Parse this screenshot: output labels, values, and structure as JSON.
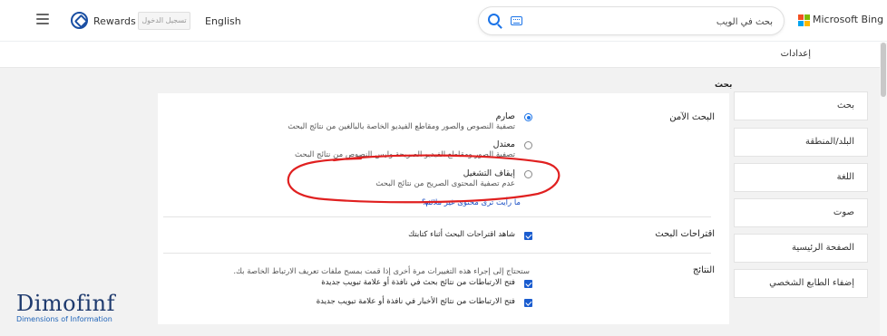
{
  "header": {
    "rewards_label": "Rewards",
    "signin_label": "تسجيل الدخول",
    "language_link": "English",
    "search_placeholder": "بحث في الويب",
    "brand": "Microsoft Bing"
  },
  "colors": {
    "accent": "#1a73e8",
    "annotation": "#e02020",
    "microsoft_logo": [
      "#f25022",
      "#7fba00",
      "#00a4ef",
      "#ffb900"
    ]
  },
  "page": {
    "title": "إعدادات",
    "section_label": "بحث"
  },
  "nav": {
    "items": [
      {
        "label": "بحث"
      },
      {
        "label": "البلد/المنطقة"
      },
      {
        "label": "اللغة"
      },
      {
        "label": "صوت"
      },
      {
        "label": "الصفحة الرئيسية"
      },
      {
        "label": "إضفاء الطابع الشخصي"
      }
    ]
  },
  "safe_search": {
    "label": "البحث الآمن",
    "selected": "strict",
    "options": [
      {
        "id": "strict",
        "title": "صارم",
        "description": "تصفية النصوص والصور ومقاطع الفيديو الخاصة بالبالغين من نتائج البحث"
      },
      {
        "id": "moderate",
        "title": "معتدل",
        "description": "تصفية الصور ومقاطع الفيديو الصريحة وليس النصوص من نتائج البحث"
      },
      {
        "id": "off",
        "title": "إيقاف التشغيل",
        "description": "عدم تصفية المحتوى الصريح من نتائج البحث"
      }
    ],
    "report_link": "ما رأيت ترى محتوى غير ملائم؟"
  },
  "suggestions": {
    "label": "اقتراحات البحث",
    "checkbox_label": "شاهد اقتراحات البحث أثناء كتابتك",
    "checked": true
  },
  "results": {
    "label": "النتائج",
    "note": "ستحتاج إلى إجراء هذه التغييرات مرة أخرى إذا قمت بمسح ملفات تعريف الارتباط الخاصة بك.",
    "checkbox1_label": "فتح الارتباطات من نتائج بحث في نافذة أو علامة تبويب جديدة",
    "checkbox2_label": "فتح الارتباطات من نتائج الأخبار في نافذة أو علامة تبويب جديدة",
    "checkbox1_checked": true,
    "checkbox2_checked": true
  },
  "watermark": {
    "name": "Dimofinf",
    "tagline": "Dimensions of Information"
  }
}
